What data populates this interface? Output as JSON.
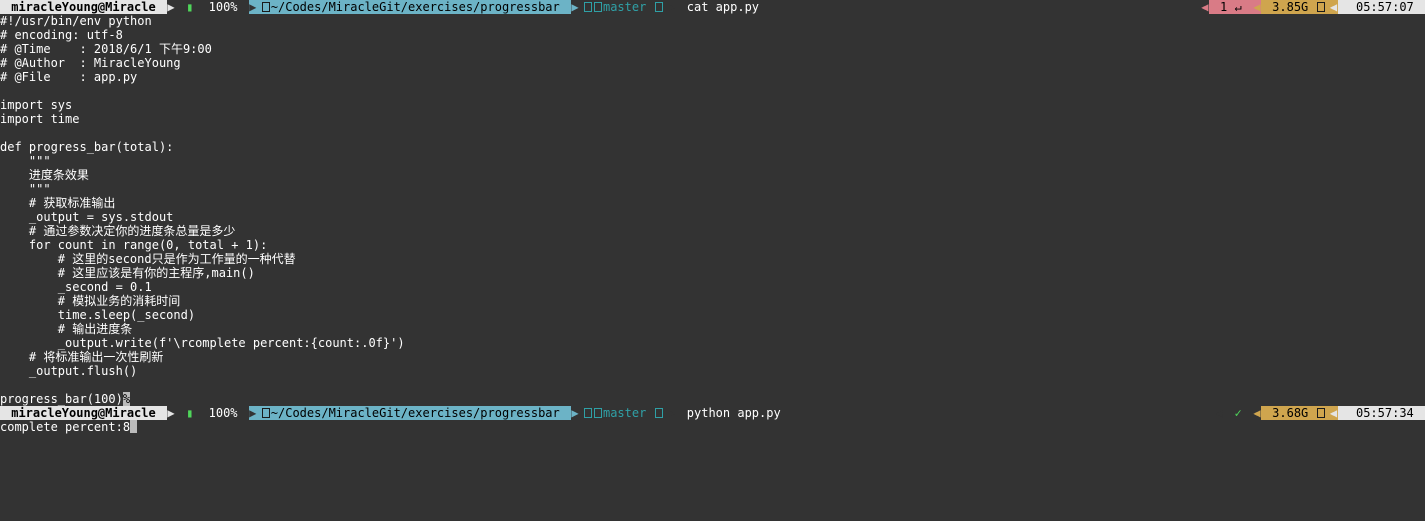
{
  "prompt1": {
    "host": " miracleYoung@Miracle ",
    "battery_pct": " 100% ",
    "path": "~/Codes/MiracleGit/exercises/progressbar ",
    "branch_label": "master ",
    "command": " cat app.py",
    "right": {
      "red": " 1 ↵ ",
      "mem": " 3.85G ",
      "time": "  05:57:07 "
    }
  },
  "code_lines": [
    "#!/usr/bin/env python",
    "# encoding: utf-8",
    "# @Time    : 2018/6/1 下午9:00",
    "# @Author  : MiracleYoung",
    "# @File    : app.py",
    "",
    "import sys",
    "import time",
    "",
    "def progress_bar(total):",
    "    \"\"\"",
    "    进度条效果",
    "    \"\"\"",
    "    # 获取标准输出",
    "    _output = sys.stdout",
    "    # 通过参数决定你的进度条总量是多少",
    "    for count in range(0, total + 1):",
    "        # 这里的second只是作为工作量的一种代替",
    "        # 这里应该是有你的主程序,main()",
    "        _second = 0.1",
    "        # 模拟业务的消耗时间",
    "        time.sleep(_second)",
    "        # 输出进度条",
    "        _output.write(f'\\rcomplete percent:{count:.0f}')",
    "    # 将标准输出一次性刷新",
    "    _output.flush()",
    "",
    "progress_bar(100)"
  ],
  "prompt2": {
    "host": " miracleYoung@Miracle ",
    "battery_pct": " 100% ",
    "path": "~/Codes/MiracleGit/exercises/progressbar ",
    "branch_label": "master ",
    "command": " python app.py",
    "right": {
      "check": " ✓ ",
      "mem": " 3.68G ",
      "time": "  05:57:34 "
    }
  },
  "output_line": "complete percent:8"
}
